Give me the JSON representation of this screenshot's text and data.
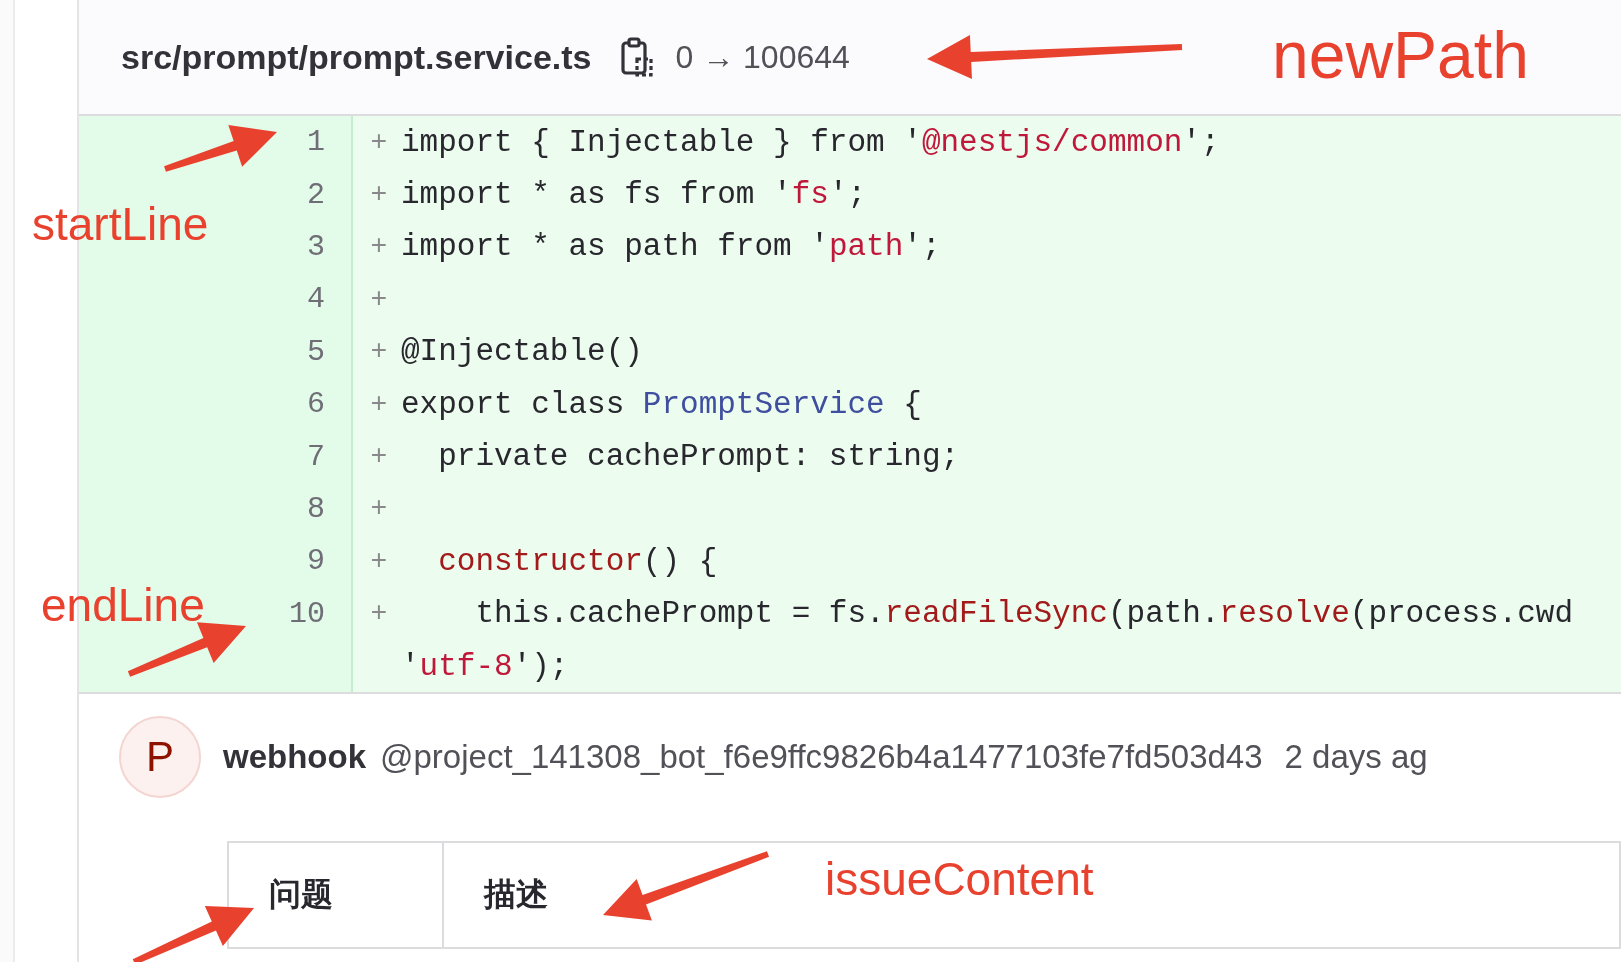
{
  "file_header": {
    "path": "src/prompt/prompt.service.ts",
    "mode_change": "0 → 100644"
  },
  "diff_lines": [
    {
      "number": "1",
      "marker": "+",
      "tokens": [
        {
          "text": "import { Injectable } from '",
          "kind": "plain"
        },
        {
          "text": "@nestjs/common",
          "kind": "string"
        },
        {
          "text": "';",
          "kind": "plain"
        }
      ]
    },
    {
      "number": "2",
      "marker": "+",
      "tokens": [
        {
          "text": "import * as fs from '",
          "kind": "plain"
        },
        {
          "text": "fs",
          "kind": "string"
        },
        {
          "text": "';",
          "kind": "plain"
        }
      ]
    },
    {
      "number": "3",
      "marker": "+",
      "tokens": [
        {
          "text": "import * as path from '",
          "kind": "plain"
        },
        {
          "text": "path",
          "kind": "string"
        },
        {
          "text": "';",
          "kind": "plain"
        }
      ]
    },
    {
      "number": "4",
      "marker": "+"
    },
    {
      "number": "5",
      "marker": "+",
      "tokens": [
        {
          "text": "@Injectable()",
          "kind": "plain"
        }
      ]
    },
    {
      "number": "6",
      "marker": "+",
      "tokens": [
        {
          "text": "export class ",
          "kind": "plain"
        },
        {
          "text": "PromptService",
          "kind": "type"
        },
        {
          "text": " {",
          "kind": "plain"
        }
      ]
    },
    {
      "number": "7",
      "marker": "+",
      "tokens": [
        {
          "text": "  private cachePrompt: string;",
          "kind": "plain"
        }
      ]
    },
    {
      "number": "8",
      "marker": "+"
    },
    {
      "number": "9",
      "marker": "+",
      "tokens": [
        {
          "text": "  constructor",
          "kind": "function"
        },
        {
          "text": "() {",
          "kind": "plain"
        }
      ]
    },
    {
      "number": "10",
      "marker": "+",
      "tokens": [
        {
          "text": "    this.cachePrompt = fs.",
          "kind": "plain"
        },
        {
          "text": "readFileSync",
          "kind": "function"
        },
        {
          "text": "(path.",
          "kind": "plain"
        },
        {
          "text": "resolve",
          "kind": "function"
        },
        {
          "text": "(process.cwd",
          "kind": "plain"
        }
      ]
    },
    {
      "tokens": [
        {
          "text": "'",
          "kind": "plain"
        },
        {
          "text": "utf-8",
          "kind": "string"
        },
        {
          "text": "');",
          "kind": "plain"
        }
      ]
    }
  ],
  "comment": {
    "avatar_letter": "P",
    "author": "webhook",
    "handle": "@project_141308_bot_f6e9ffc9826b4a1477103fe7fd503d43",
    "time": "2 days ag"
  },
  "table": {
    "columns": [
      "问题",
      "描述"
    ]
  },
  "annotations": [
    {
      "label": "newPath"
    },
    {
      "label": "startLine"
    },
    {
      "label": "endLine"
    },
    {
      "label": "issueContent"
    }
  ]
}
